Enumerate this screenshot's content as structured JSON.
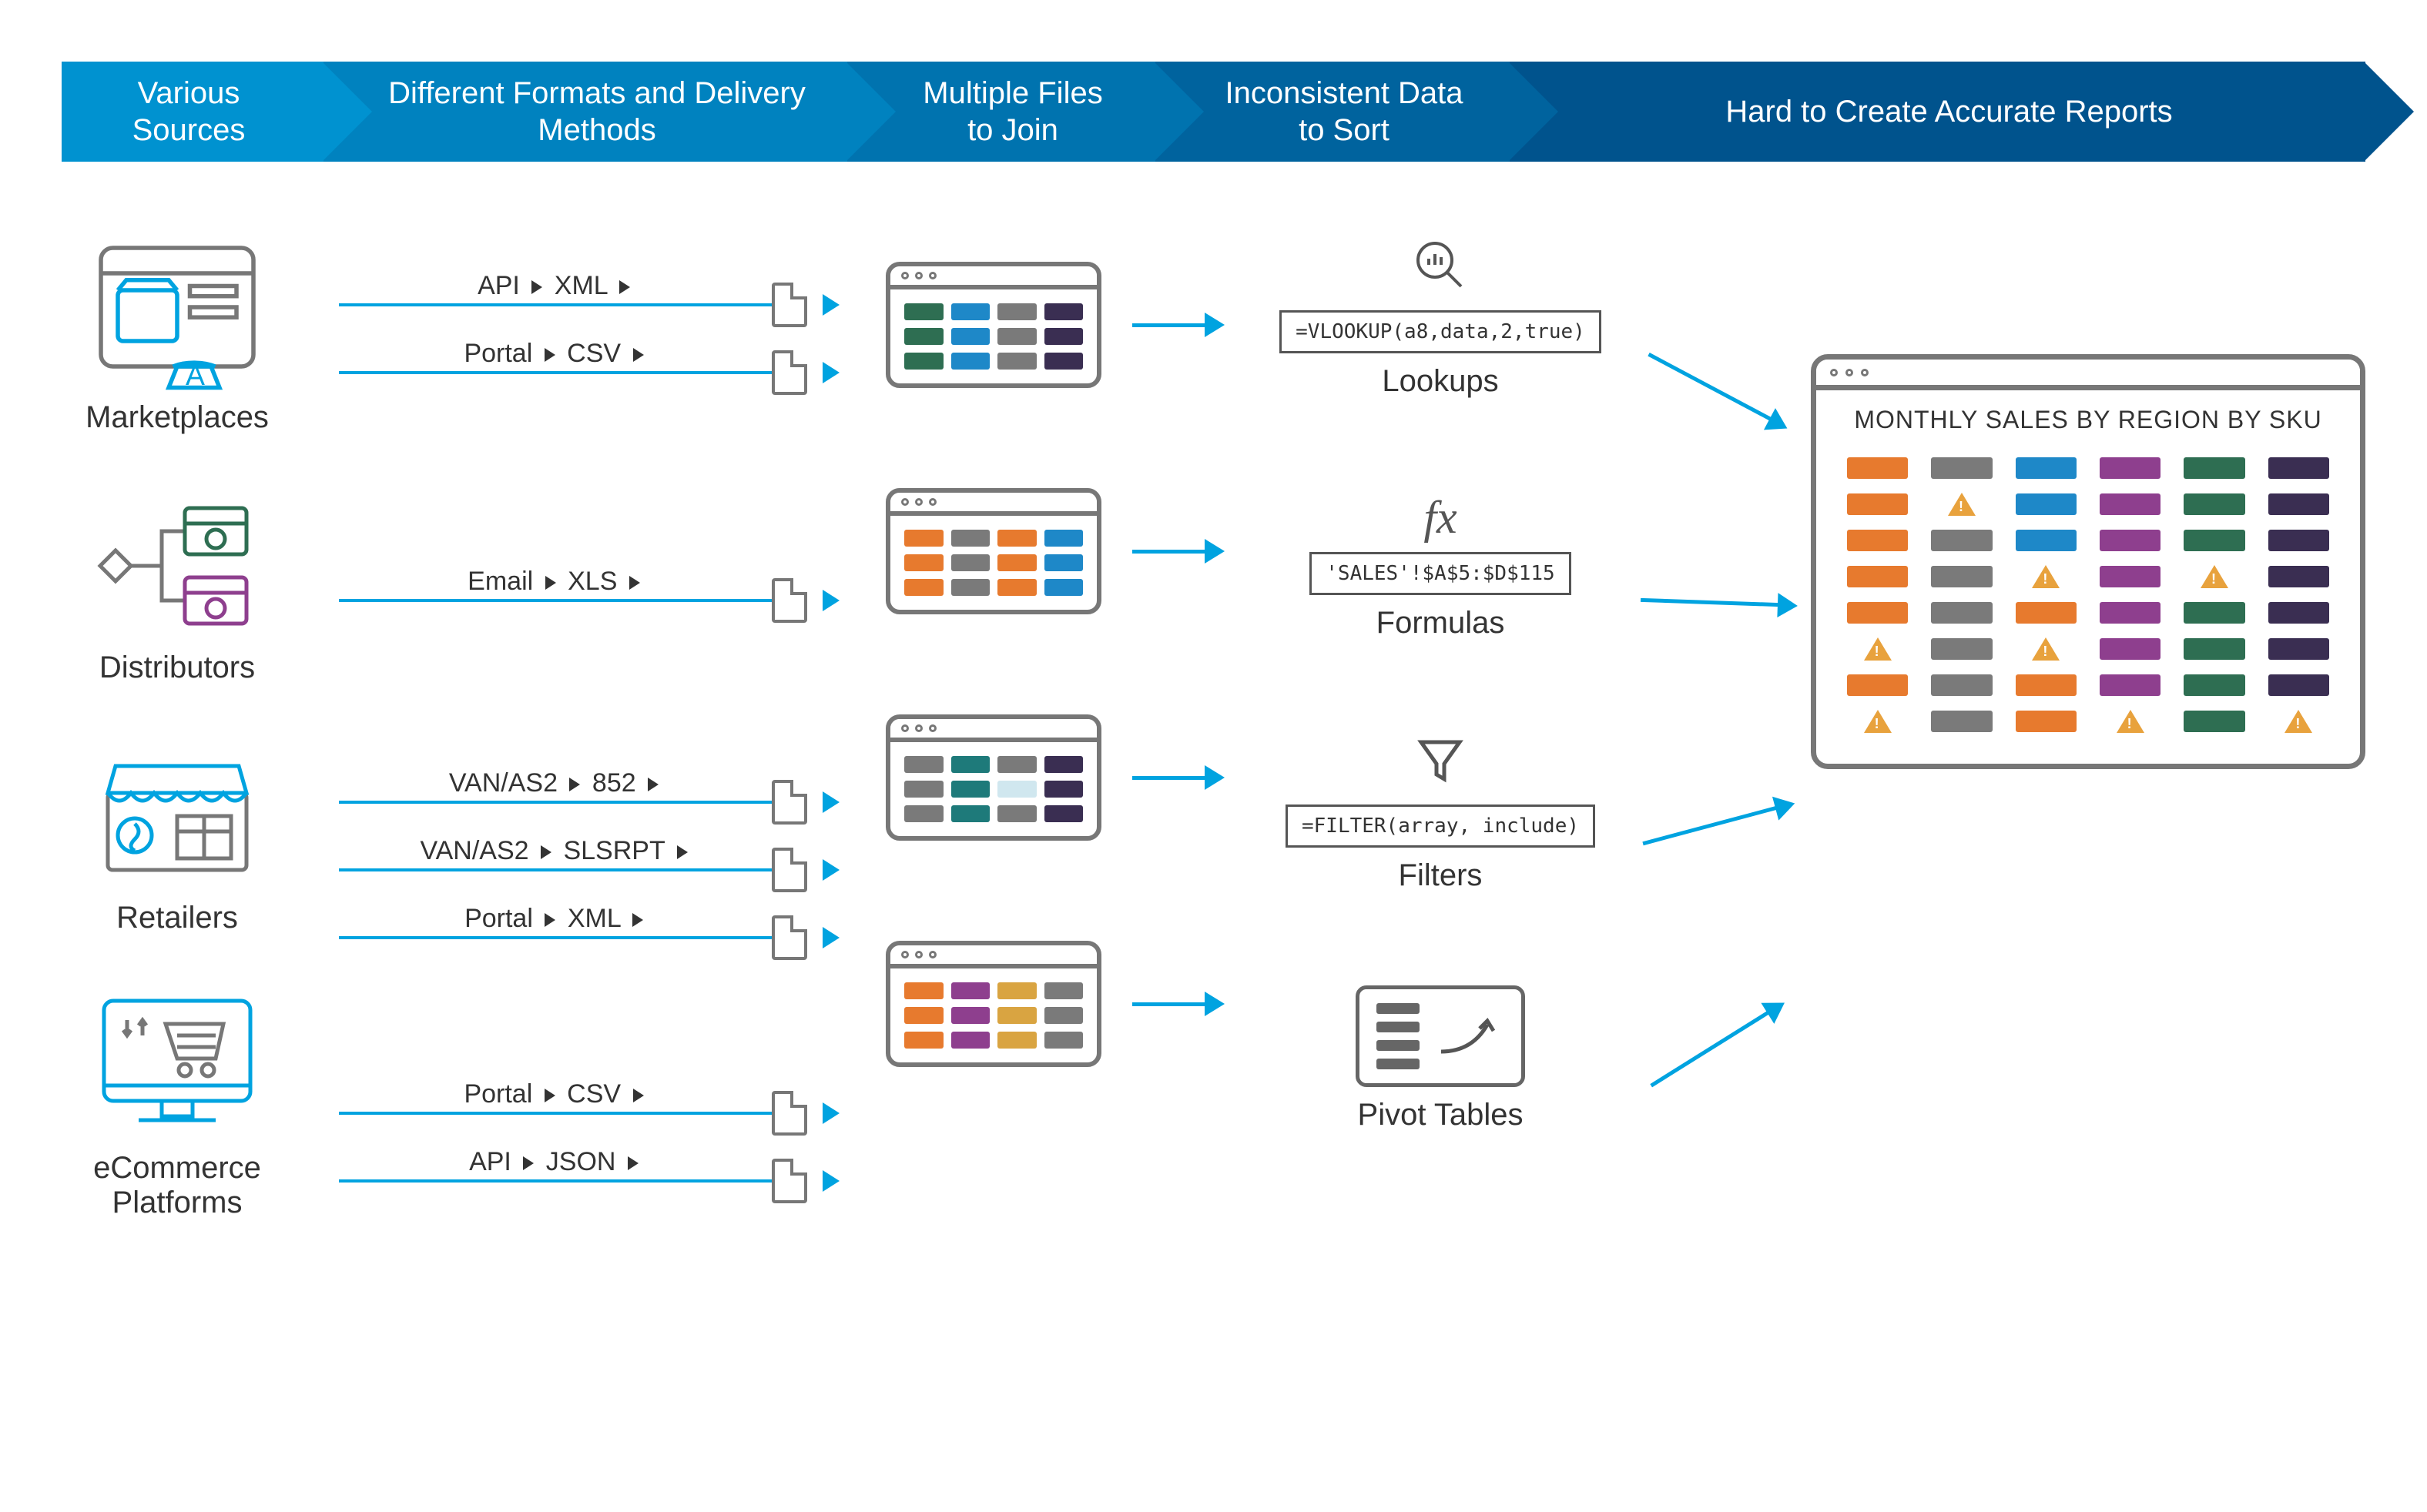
{
  "header": {
    "steps": [
      "Various Sources",
      "Different Formats and Delivery Methods",
      "Multiple Files to Join",
      "Inconsistent Data to Sort",
      "Hard to Create Accurate Reports"
    ]
  },
  "sources": [
    {
      "id": "marketplaces",
      "label": "Marketplaces"
    },
    {
      "id": "distributors",
      "label": "Distributors"
    },
    {
      "id": "retailers",
      "label": "Retailers"
    },
    {
      "id": "ecommerce",
      "label": "eCommerce Platforms"
    }
  ],
  "formats": {
    "marketplaces": [
      {
        "left": "API",
        "right": "XML"
      },
      {
        "left": "Portal",
        "right": "CSV"
      }
    ],
    "distributors": [
      {
        "left": "Email",
        "right": "XLS"
      }
    ],
    "retailers": [
      {
        "left": "VAN/AS2",
        "right": "852"
      },
      {
        "left": "VAN/AS2",
        "right": "SLSRPT"
      },
      {
        "left": "Portal",
        "right": "XML"
      }
    ],
    "ecommerce": [
      {
        "left": "Portal",
        "right": "CSV"
      },
      {
        "left": "API",
        "right": "JSON"
      }
    ]
  },
  "operations": {
    "lookups": {
      "formula": "=VLOOKUP(a8,data,2,true)",
      "label": "Lookups"
    },
    "formulas": {
      "formula": "'SALES'!$A$5:$D$115",
      "label": "Formulas"
    },
    "filters": {
      "formula": "=FILTER(array, include)",
      "label": "Filters"
    },
    "pivot": {
      "label": "Pivot Tables"
    }
  },
  "report": {
    "title": "MONTHLY SALES BY REGION BY SKU"
  },
  "colors": {
    "accent": "#00A3E0",
    "grey": "#777777",
    "header_gradient": [
      "#0092D0",
      "#0082BF",
      "#0073AF",
      "#00639E",
      "#00538D"
    ]
  }
}
